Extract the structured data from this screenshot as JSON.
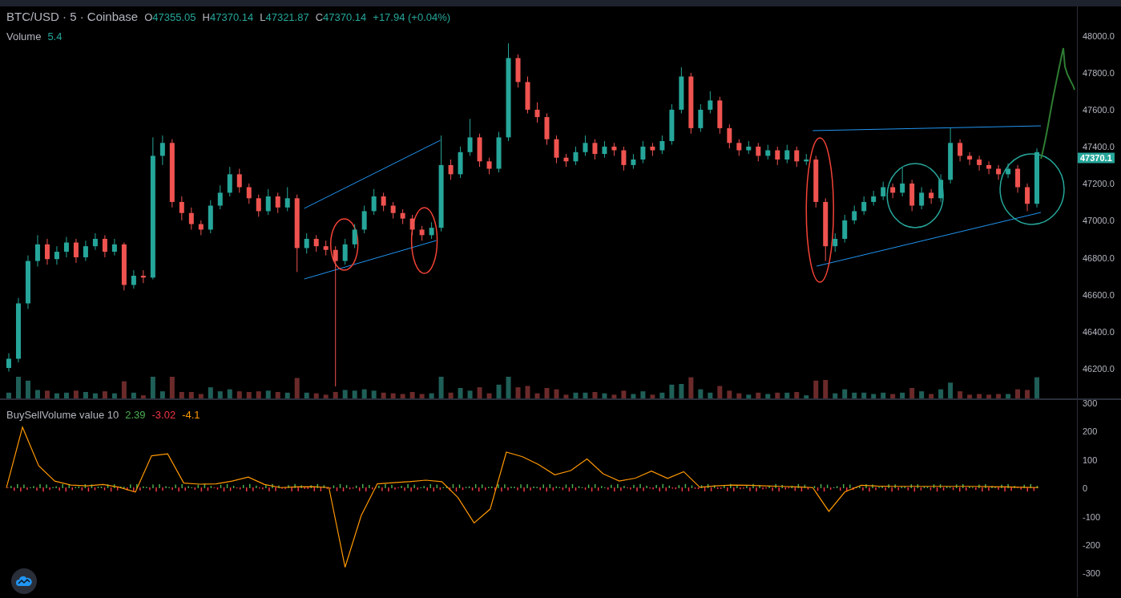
{
  "legend": {
    "symbol": "BTC/USD · 5 · Coinbase",
    "ohlc": [
      {
        "label": "O",
        "value": "47355.05"
      },
      {
        "label": "H",
        "value": "47370.14"
      },
      {
        "label": "L",
        "value": "47321.87"
      },
      {
        "label": "C",
        "value": "47370.14"
      }
    ],
    "change": "+17.94 (+0.04%)"
  },
  "volume": {
    "name": "Volume",
    "value": "5.4"
  },
  "price_chart": {
    "last_price": "47370.1",
    "chart_data": {
      "type": "candlestick",
      "ylim": [
        46035,
        48160
      ],
      "yticks": [
        {
          "value": 48000,
          "label": "48000.0"
        },
        {
          "value": 47800,
          "label": "47800.0"
        },
        {
          "value": 47600,
          "label": "47600.0"
        },
        {
          "value": 47400,
          "label": "47400.0"
        },
        {
          "value": 47200,
          "label": "47200.0"
        },
        {
          "value": 47000,
          "label": "47000.0"
        },
        {
          "value": 46800,
          "label": "46800.0"
        },
        {
          "value": 46600,
          "label": "46600.0"
        },
        {
          "value": 46400,
          "label": "46400.0"
        },
        {
          "value": 46200,
          "label": "46200.0"
        }
      ],
      "ohlc": [
        [
          46200,
          46280,
          46180,
          46250
        ],
        [
          46250,
          46580,
          46230,
          46550
        ],
        [
          46550,
          46810,
          46520,
          46780
        ],
        [
          46780,
          46920,
          46750,
          46870
        ],
        [
          46870,
          46900,
          46760,
          46790
        ],
        [
          46790,
          46860,
          46760,
          46830
        ],
        [
          46830,
          46910,
          46800,
          46880
        ],
        [
          46880,
          46900,
          46770,
          46800
        ],
        [
          46800,
          46890,
          46780,
          46860
        ],
        [
          46860,
          46930,
          46840,
          46900
        ],
        [
          46900,
          46920,
          46800,
          46830
        ],
        [
          46830,
          46900,
          46810,
          46870
        ],
        [
          46870,
          46880,
          46620,
          46650
        ],
        [
          46650,
          46730,
          46630,
          46700
        ],
        [
          46700,
          46730,
          46660,
          46690
        ],
        [
          46690,
          47450,
          46680,
          47350
        ],
        [
          47350,
          47460,
          47300,
          47420
        ],
        [
          47420,
          47440,
          47070,
          47100
        ],
        [
          47100,
          47130,
          47000,
          47040
        ],
        [
          47040,
          47070,
          46950,
          46980
        ],
        [
          46980,
          47000,
          46920,
          46950
        ],
        [
          46950,
          47110,
          46930,
          47080
        ],
        [
          47080,
          47190,
          47060,
          47150
        ],
        [
          47150,
          47290,
          47130,
          47250
        ],
        [
          47250,
          47280,
          47150,
          47180
        ],
        [
          47180,
          47200,
          47090,
          47120
        ],
        [
          47120,
          47140,
          47020,
          47050
        ],
        [
          47050,
          47170,
          47030,
          47130
        ],
        [
          47130,
          47150,
          47040,
          47070
        ],
        [
          47070,
          47180,
          47050,
          47120
        ],
        [
          47120,
          47140,
          46720,
          46850
        ],
        [
          46850,
          46930,
          46820,
          46900
        ],
        [
          46900,
          46920,
          46830,
          46860
        ],
        [
          46860,
          46890,
          46810,
          46840
        ],
        [
          46840,
          46860,
          46100,
          46780
        ],
        [
          46780,
          46900,
          46760,
          46870
        ],
        [
          46870,
          46980,
          46850,
          46950
        ],
        [
          46950,
          47080,
          46930,
          47050
        ],
        [
          47050,
          47170,
          47030,
          47130
        ],
        [
          47130,
          47150,
          47050,
          47080
        ],
        [
          47080,
          47100,
          47010,
          47040
        ],
        [
          47040,
          47060,
          46980,
          47010
        ],
        [
          47010,
          47030,
          46920,
          46950
        ],
        [
          46950,
          46970,
          46890,
          46920
        ],
        [
          46920,
          46990,
          46900,
          46960
        ],
        [
          46960,
          47460,
          46940,
          47300
        ],
        [
          47300,
          47330,
          47220,
          47250
        ],
        [
          47250,
          47400,
          47230,
          47370
        ],
        [
          47370,
          47550,
          47350,
          47450
        ],
        [
          47450,
          47470,
          47290,
          47320
        ],
        [
          47320,
          47340,
          47250,
          47280
        ],
        [
          47280,
          47480,
          47260,
          47450
        ],
        [
          47450,
          47960,
          47430,
          47880
        ],
        [
          47880,
          47900,
          47720,
          47750
        ],
        [
          47750,
          47780,
          47580,
          47600
        ],
        [
          47600,
          47640,
          47530,
          47560
        ],
        [
          47560,
          47580,
          47410,
          47440
        ],
        [
          47440,
          47460,
          47310,
          47340
        ],
        [
          47340,
          47360,
          47290,
          47320
        ],
        [
          47320,
          47400,
          47300,
          47370
        ],
        [
          47370,
          47460,
          47350,
          47420
        ],
        [
          47420,
          47440,
          47330,
          47360
        ],
        [
          47360,
          47430,
          47340,
          47400
        ],
        [
          47400,
          47420,
          47350,
          47380
        ],
        [
          47380,
          47400,
          47270,
          47300
        ],
        [
          47300,
          47360,
          47280,
          47330
        ],
        [
          47330,
          47430,
          47310,
          47400
        ],
        [
          47400,
          47420,
          47350,
          47380
        ],
        [
          47380,
          47460,
          47360,
          47430
        ],
        [
          47430,
          47630,
          47410,
          47600
        ],
        [
          47600,
          47830,
          47580,
          47780
        ],
        [
          47780,
          47800,
          47470,
          47500
        ],
        [
          47500,
          47630,
          47480,
          47600
        ],
        [
          47600,
          47700,
          47580,
          47650
        ],
        [
          47650,
          47670,
          47470,
          47500
        ],
        [
          47500,
          47520,
          47390,
          47420
        ],
        [
          47420,
          47440,
          47350,
          47380
        ],
        [
          47380,
          47430,
          47360,
          47400
        ],
        [
          47400,
          47420,
          47320,
          47350
        ],
        [
          47350,
          47410,
          47330,
          47380
        ],
        [
          47380,
          47400,
          47300,
          47330
        ],
        [
          47330,
          47410,
          47310,
          47380
        ],
        [
          47380,
          47400,
          47290,
          47320
        ],
        [
          47320,
          47360,
          47300,
          47330
        ],
        [
          47330,
          47350,
          47070,
          47100
        ],
        [
          47100,
          47120,
          46780,
          46860
        ],
        [
          46860,
          46930,
          46830,
          46900
        ],
        [
          46900,
          47030,
          46880,
          47000
        ],
        [
          47000,
          47080,
          46980,
          47050
        ],
        [
          47050,
          47130,
          47030,
          47100
        ],
        [
          47100,
          47160,
          47080,
          47130
        ],
        [
          47130,
          47210,
          47110,
          47180
        ],
        [
          47180,
          47200,
          47120,
          47150
        ],
        [
          47150,
          47290,
          47130,
          47200
        ],
        [
          47200,
          47220,
          47050,
          47080
        ],
        [
          47080,
          47180,
          47060,
          47150
        ],
        [
          47150,
          47170,
          47090,
          47120
        ],
        [
          47120,
          47250,
          47100,
          47220
        ],
        [
          47220,
          47500,
          47200,
          47420
        ],
        [
          47420,
          47440,
          47320,
          47350
        ],
        [
          47350,
          47370,
          47300,
          47330
        ],
        [
          47330,
          47350,
          47270,
          47300
        ],
        [
          47300,
          47320,
          47250,
          47280
        ],
        [
          47280,
          47300,
          47220,
          47250
        ],
        [
          47250,
          47310,
          47230,
          47280
        ],
        [
          47280,
          47300,
          47150,
          47180
        ],
        [
          47180,
          47200,
          47050,
          47090
        ],
        [
          47090,
          47390,
          47070,
          47370
        ]
      ]
    }
  },
  "indicator": {
    "values": [
      {
        "text": "2.39",
        "color": "#4caf50"
      },
      {
        "text": "-3.02",
        "color": "#f23645"
      },
      {
        "text": "-4.1",
        "color": "#ff9800"
      }
    ],
    "chart_data": {
      "type": "line",
      "ylim": [
        -386,
        310
      ],
      "yticks": [
        {
          "value": 300,
          "label": "300"
        },
        {
          "value": 200,
          "label": "200"
        },
        {
          "value": 100,
          "label": "100"
        },
        {
          "value": 0,
          "label": "0"
        },
        {
          "value": -100,
          "label": "-100"
        },
        {
          "value": -200,
          "label": "-200"
        },
        {
          "value": -300,
          "label": "-300"
        }
      ],
      "series": [
        {
          "name": "BuySellVolume value 10",
          "color": "#ff9800",
          "values": [
            0,
            214,
            78,
            24,
            10,
            7,
            12,
            2,
            -15,
            113,
            120,
            17,
            13,
            14,
            24,
            38,
            12,
            1,
            3,
            4,
            1,
            -280,
            -98,
            14,
            18,
            22,
            27,
            22,
            -34,
            -124,
            -75,
            126,
            110,
            82,
            46,
            61,
            102,
            50,
            24,
            34,
            59,
            33,
            57,
            2,
            7,
            10,
            9,
            7,
            5,
            3,
            1,
            -83,
            -14,
            9,
            6,
            5,
            5,
            5,
            5,
            5,
            5,
            4,
            3,
            2,
            1
          ]
        }
      ]
    }
  }
}
